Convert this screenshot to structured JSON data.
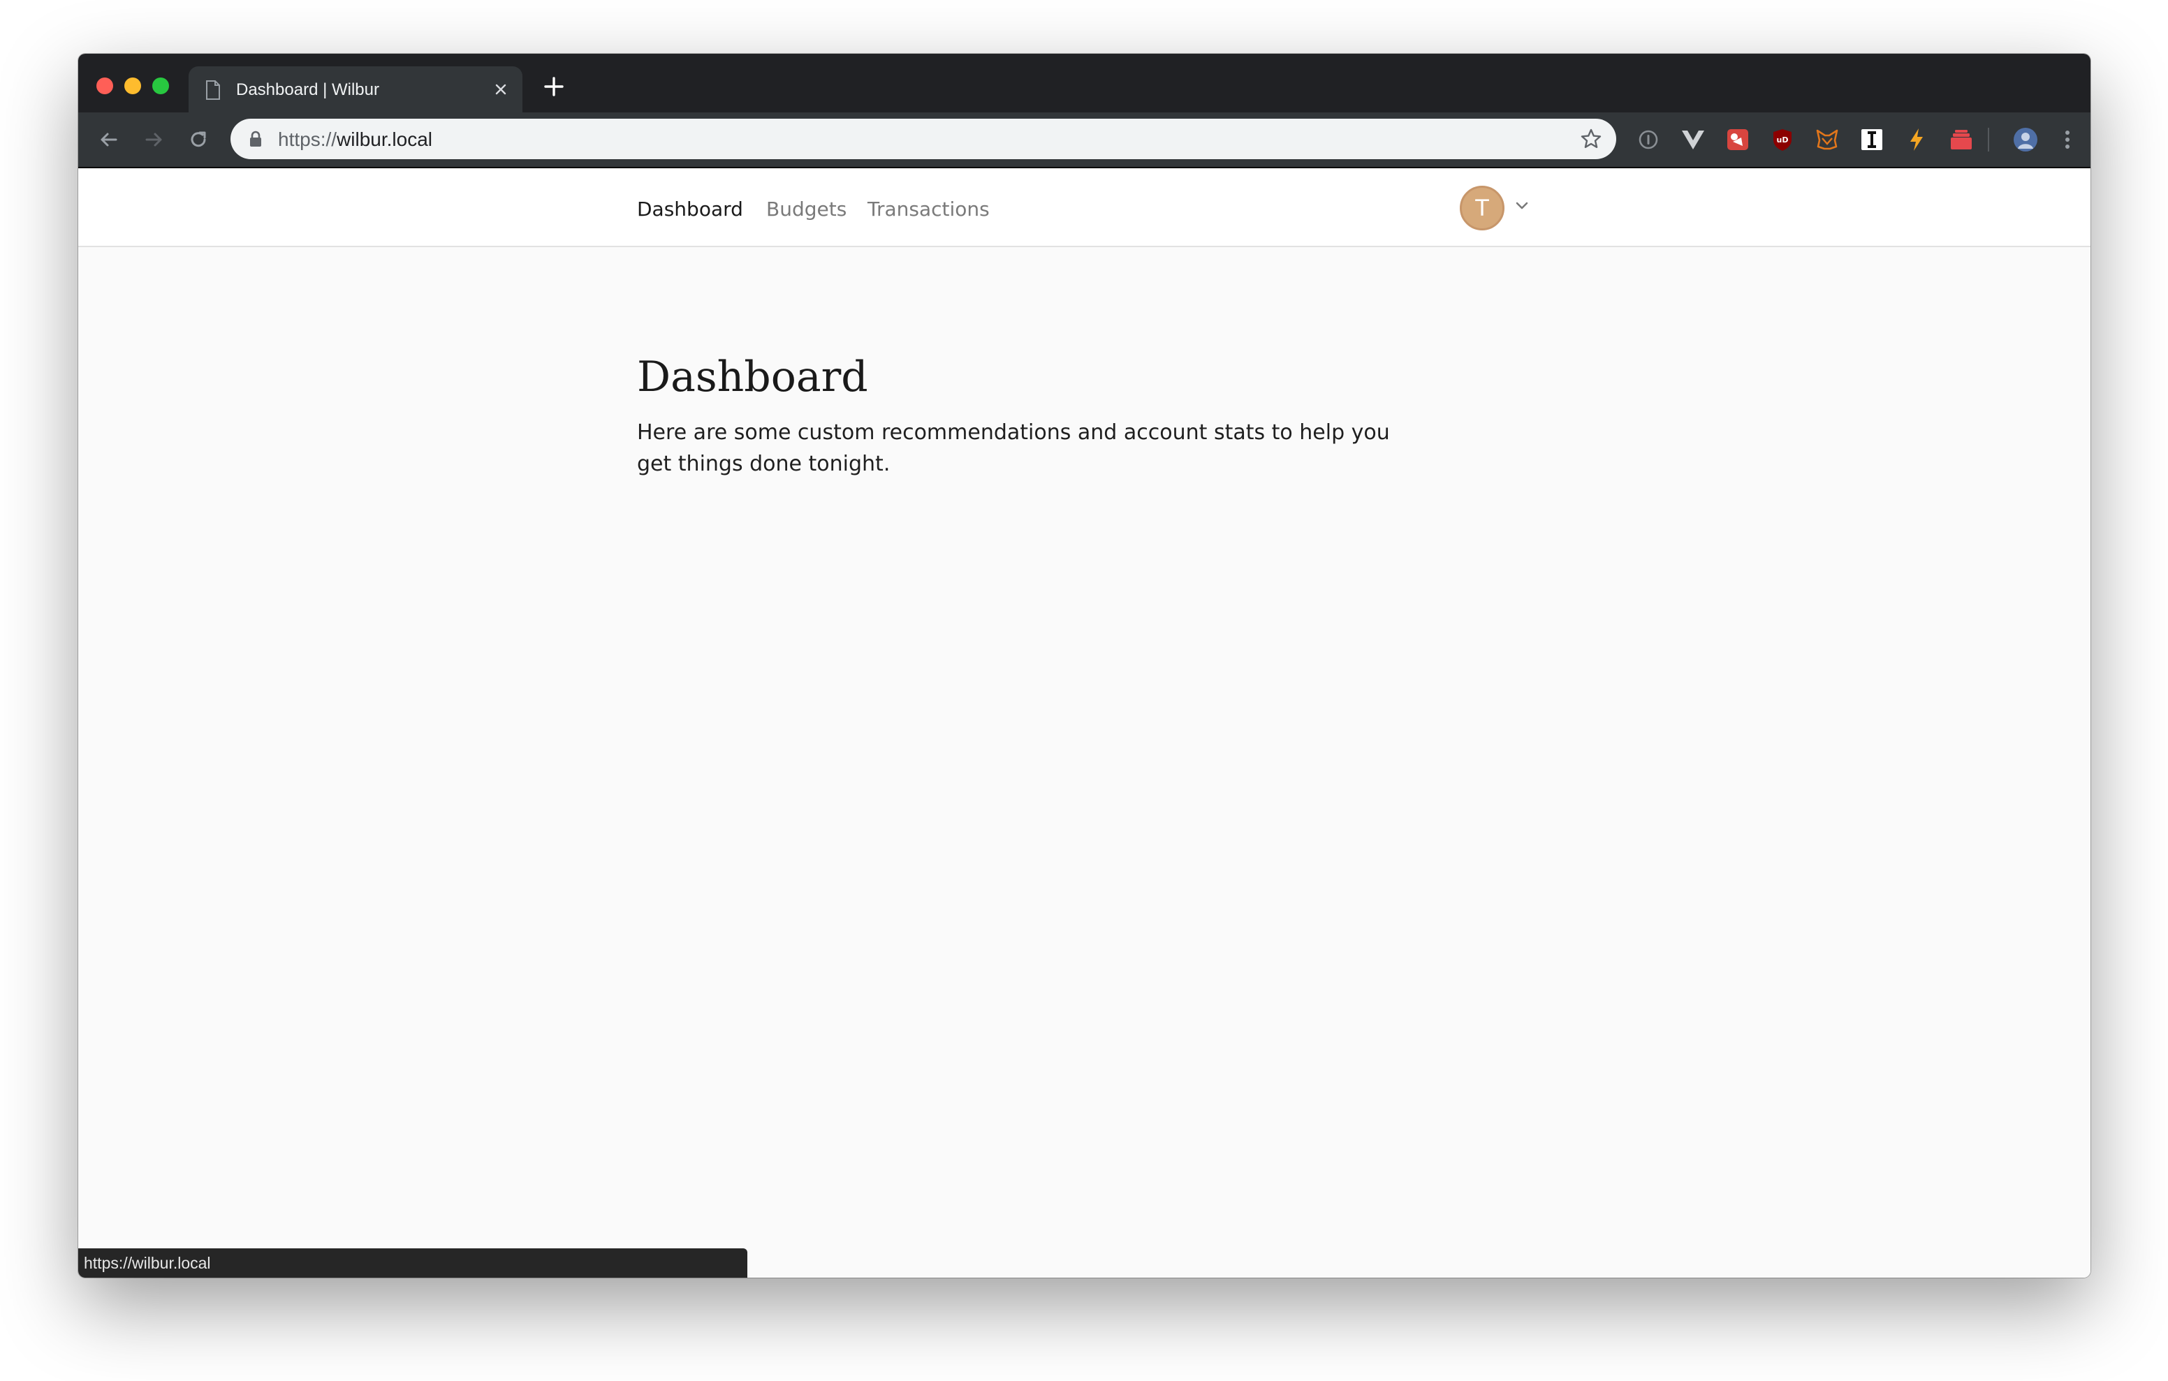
{
  "browser": {
    "tab": {
      "title": "Dashboard | Wilbur"
    },
    "address_bar": {
      "scheme": "https://",
      "host": "wilbur.local"
    },
    "status_url": "https://wilbur.local"
  },
  "site_nav": {
    "links": [
      {
        "label": "Dashboard",
        "active": true
      },
      {
        "label": "Budgets",
        "active": false
      },
      {
        "label": "Transactions",
        "active": false
      }
    ],
    "avatar_initial": "T"
  },
  "main": {
    "title": "Dashboard",
    "description": "Here are some custom recommendations and account stats to help you get things done tonight."
  },
  "colors": {
    "tab_strip": "#202124",
    "toolbar": "#323639",
    "avatar": "#d6a97a",
    "page_background": "#fafafa"
  },
  "extensions": [
    "info-icon",
    "vue-devtools-icon",
    "extension-puzzle-icon",
    "ublock-origin-icon",
    "metamask-fox-icon",
    "instapaper-icon",
    "lightning-icon",
    "stack-icon",
    "profile-icon",
    "menu-icon"
  ]
}
